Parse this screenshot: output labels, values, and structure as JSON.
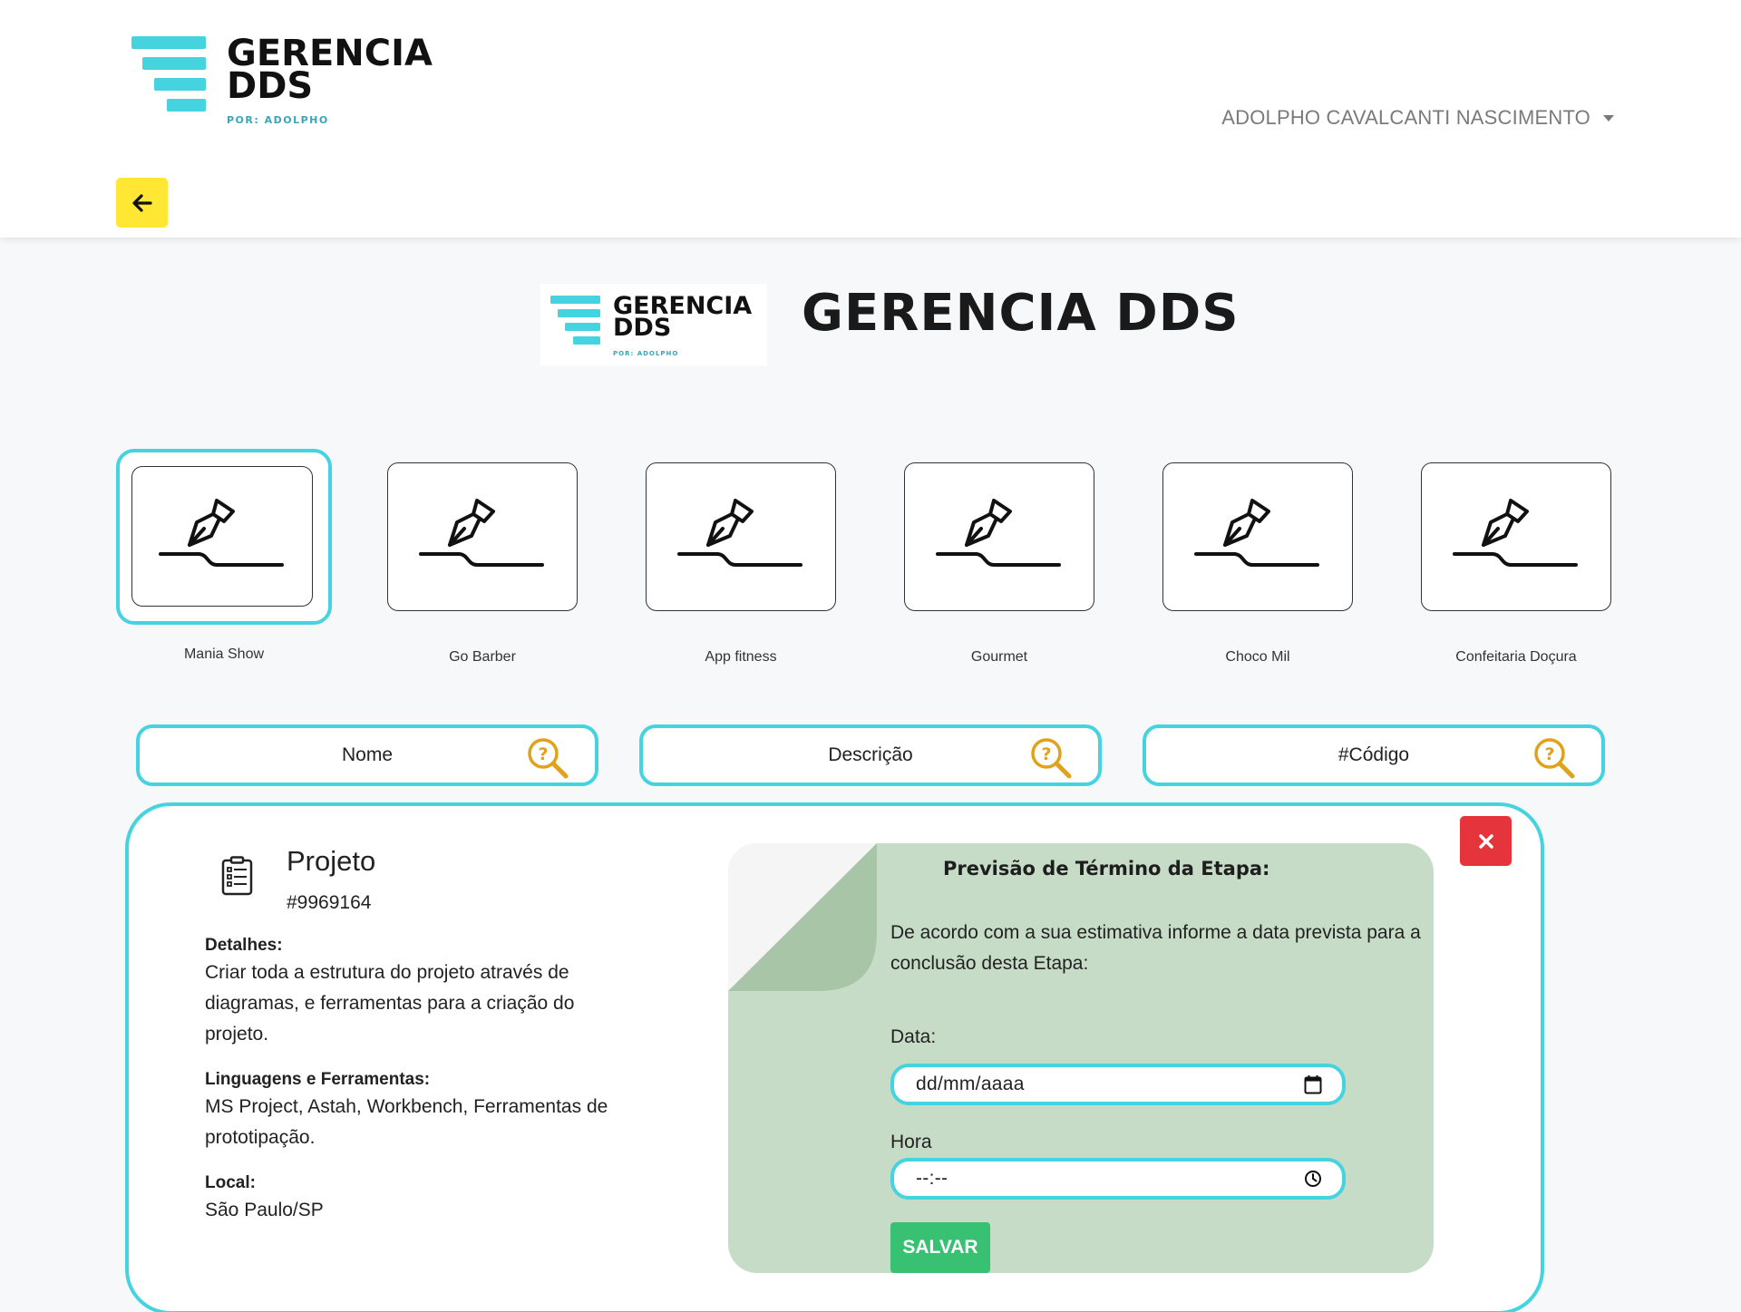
{
  "brand": {
    "logo_line1": "GERENCIA",
    "logo_line2": "DDS",
    "logo_tagline": "POR: ADOLPHO",
    "accent_color": "#45d3e0"
  },
  "navbar": {
    "user_name": "ADOLPHO CAVALCANTI NASCIMENTO",
    "back_icon": "arrow-left-icon"
  },
  "header": {
    "title": "GERENCIA DDS"
  },
  "projects": [
    {
      "name": "Mania Show",
      "icon": "pen-signature-icon",
      "selected": true
    },
    {
      "name": "Go Barber",
      "icon": "pen-signature-icon",
      "selected": false
    },
    {
      "name": "App fitness",
      "icon": "pen-signature-icon",
      "selected": false
    },
    {
      "name": "Gourmet",
      "icon": "pen-signature-icon",
      "selected": false
    },
    {
      "name": "Choco Mil",
      "icon": "pen-signature-icon",
      "selected": false
    },
    {
      "name": "Confeitaria Doçura",
      "icon": "pen-signature-icon",
      "selected": false
    }
  ],
  "search": {
    "name_placeholder": "Nome",
    "description_placeholder": "Descrição",
    "code_placeholder": "#Código"
  },
  "detail": {
    "heading": "Projeto",
    "code": "#9969164",
    "details_label": "Detalhes:",
    "details_text": "Criar toda a estrutura do projeto através de diagramas, e ferramentas para a criação do projeto.",
    "tools_label": "Linguagens e Ferramentas:",
    "tools_text": "MS Project, Astah, Workbench, Ferramentas de prototipação.",
    "location_label": "Local:",
    "location_text": "São Paulo/SP"
  },
  "deadline_form": {
    "title": "Previsão de Término da Etapa:",
    "instructions": "De acordo com a sua estimativa informe a data prevista para a conclusão desta Etapa:",
    "date_label": "Data:",
    "date_value": "dd/mm/aaaa",
    "time_label": "Hora",
    "time_value": "--:--",
    "save_label": "SALVAR"
  }
}
